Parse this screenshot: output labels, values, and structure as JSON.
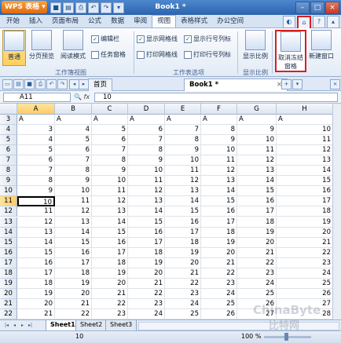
{
  "window": {
    "app_name": "WPS 表格",
    "doc_title": "Book1 *"
  },
  "menu": [
    "开始",
    "插入",
    "页面布局",
    "公式",
    "数据",
    "审阅",
    "视图",
    "表格样式",
    "办公空间"
  ],
  "menu_active_index": 6,
  "ribbon": {
    "normal": "普通",
    "page_break": "分页预览",
    "reading": "阅读模式",
    "formula_bar": "编辑栏",
    "taskpane": "任务窗格",
    "group_workbook_view": "工作簿视图",
    "show_gridlines": "显示网格线",
    "print_gridlines": "打印网格线",
    "show_rowcol_headers": "显示行号列标",
    "print_rowcol_headers": "打印行号列标",
    "group_sheet_options": "工作表选项",
    "zoom": "显示比例",
    "group_zoom": "显示比例",
    "cancel_freeze": "取消冻结窗格",
    "new_window": "新建窗口"
  },
  "tabs": {
    "home": "首页",
    "book": "Book1 *"
  },
  "formula": {
    "cell_ref": "A11",
    "fx": "fx",
    "value": "10"
  },
  "columns": [
    "A",
    "B",
    "C",
    "D",
    "E",
    "F",
    "G",
    "H"
  ],
  "active_col": 0,
  "active_row": 11,
  "rows": [
    {
      "n": "3",
      "c": [
        "A",
        "A",
        "A",
        "A",
        "A",
        "A",
        "A",
        "A"
      ]
    },
    {
      "n": "4",
      "c": [
        "3",
        "4",
        "5",
        "6",
        "7",
        "8",
        "9",
        "10"
      ]
    },
    {
      "n": "5",
      "c": [
        "4",
        "5",
        "6",
        "7",
        "8",
        "9",
        "10",
        "11"
      ]
    },
    {
      "n": "6",
      "c": [
        "5",
        "6",
        "7",
        "8",
        "9",
        "10",
        "11",
        "12"
      ]
    },
    {
      "n": "7",
      "c": [
        "6",
        "7",
        "8",
        "9",
        "10",
        "11",
        "12",
        "13"
      ]
    },
    {
      "n": "8",
      "c": [
        "7",
        "8",
        "9",
        "10",
        "11",
        "12",
        "13",
        "14"
      ]
    },
    {
      "n": "9",
      "c": [
        "8",
        "9",
        "10",
        "11",
        "12",
        "13",
        "14",
        "15"
      ]
    },
    {
      "n": "10",
      "c": [
        "9",
        "10",
        "11",
        "12",
        "13",
        "14",
        "15",
        "16"
      ]
    },
    {
      "n": "11",
      "c": [
        "10",
        "11",
        "12",
        "13",
        "14",
        "15",
        "16",
        "17"
      ]
    },
    {
      "n": "12",
      "c": [
        "11",
        "12",
        "13",
        "14",
        "15",
        "16",
        "17",
        "18"
      ]
    },
    {
      "n": "13",
      "c": [
        "12",
        "13",
        "14",
        "15",
        "16",
        "17",
        "18",
        "19"
      ]
    },
    {
      "n": "14",
      "c": [
        "13",
        "14",
        "15",
        "16",
        "17",
        "18",
        "19",
        "20"
      ]
    },
    {
      "n": "15",
      "c": [
        "14",
        "15",
        "16",
        "17",
        "18",
        "19",
        "20",
        "21"
      ]
    },
    {
      "n": "16",
      "c": [
        "15",
        "16",
        "17",
        "18",
        "19",
        "20",
        "21",
        "22"
      ]
    },
    {
      "n": "17",
      "c": [
        "16",
        "17",
        "18",
        "19",
        "20",
        "21",
        "22",
        "23"
      ]
    },
    {
      "n": "18",
      "c": [
        "17",
        "18",
        "19",
        "20",
        "21",
        "22",
        "23",
        "24"
      ]
    },
    {
      "n": "19",
      "c": [
        "18",
        "19",
        "20",
        "21",
        "22",
        "23",
        "24",
        "25"
      ]
    },
    {
      "n": "20",
      "c": [
        "19",
        "20",
        "21",
        "22",
        "23",
        "24",
        "25",
        "26"
      ]
    },
    {
      "n": "21",
      "c": [
        "20",
        "21",
        "22",
        "23",
        "24",
        "25",
        "26",
        "27"
      ]
    },
    {
      "n": "22",
      "c": [
        "21",
        "22",
        "23",
        "24",
        "25",
        "26",
        "27",
        "28"
      ]
    }
  ],
  "sheets": [
    "Sheet1",
    "Sheet2",
    "Sheet3"
  ],
  "status": {
    "value": "10",
    "zoom": "100 %"
  },
  "watermark": {
    "line1": "ChinaByte",
    "line2": "比特网"
  },
  "colors": {
    "highlight": "#d62020",
    "selection": "#ffcc66"
  }
}
